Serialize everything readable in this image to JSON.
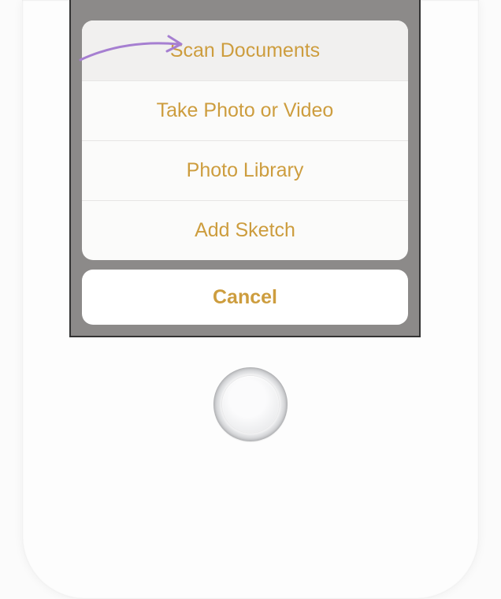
{
  "action_sheet": {
    "options": [
      {
        "label": "Scan Documents"
      },
      {
        "label": "Take Photo or Video"
      },
      {
        "label": "Photo Library"
      },
      {
        "label": "Add Sketch"
      }
    ],
    "cancel_label": "Cancel"
  },
  "colors": {
    "accent": "#cd9d3e",
    "annotation": "#a67fd1"
  }
}
